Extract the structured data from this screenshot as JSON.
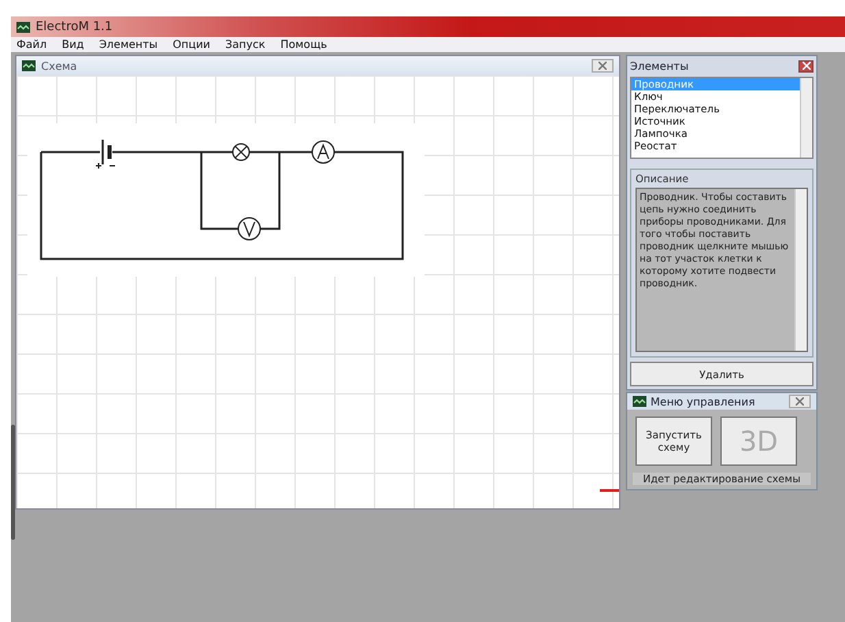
{
  "window": {
    "title": "ElectroM 1.1"
  },
  "menu": [
    "Файл",
    "Вид",
    "Элементы",
    "Опции",
    "Запуск",
    "Помощь"
  ],
  "schema_window": {
    "title": "Схема"
  },
  "elements_panel": {
    "title": "Элементы",
    "items": [
      {
        "label": "Проводник",
        "selected": true
      },
      {
        "label": "Ключ",
        "selected": false
      },
      {
        "label": "Переключатель",
        "selected": false
      },
      {
        "label": "Источник",
        "selected": false
      },
      {
        "label": "Лампочка",
        "selected": false
      },
      {
        "label": "Реостат",
        "selected": false
      }
    ],
    "description_label": "Описание",
    "description": "Проводник. Чтобы составить цепь нужно соединить приборы проводниками. Для того чтобы поставить проводник щелкните мышью на тот участок клетки к которому хотите подвести проводник.",
    "delete_button": "Удалить"
  },
  "control_panel": {
    "title": "Меню управления",
    "run_button": "Запустить схему",
    "view_button": {
      "label": "3D",
      "disabled": true
    },
    "status": "Идет редактирование схемы"
  }
}
